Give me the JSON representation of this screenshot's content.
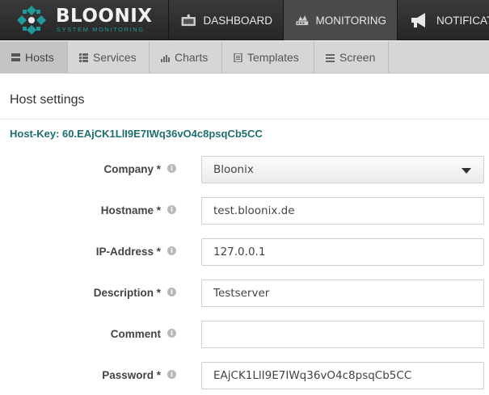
{
  "app": {
    "brand_name": "BLOONIX",
    "brand_subtitle": "SYSTEM MONITORING"
  },
  "topnav": {
    "items": [
      {
        "label": "DASHBOARD",
        "icon": "dashboard-icon"
      },
      {
        "label": "MONITORING",
        "icon": "monitoring-icon",
        "active": true
      },
      {
        "label": "NOTIFICAT",
        "icon": "megaphone-icon"
      }
    ]
  },
  "subnav": {
    "tabs": [
      {
        "label": "Hosts",
        "icon": "hosts-icon",
        "active": true
      },
      {
        "label": "Services",
        "icon": "list-icon"
      },
      {
        "label": "Charts",
        "icon": "bar-chart-icon"
      },
      {
        "label": "Templates",
        "icon": "document-icon"
      },
      {
        "label": "Screen",
        "icon": "screen-icon"
      }
    ]
  },
  "host_settings": {
    "title": "Host settings",
    "host_key": "Host-Key: 60.EAjCK1LlI9E7IWq36vO4c8psqCb5CC",
    "info_glyph": "i",
    "fields": {
      "company": {
        "label": "Company *",
        "value": "Bloonix"
      },
      "hostname": {
        "label": "Hostname *",
        "value": "test.bloonix.de"
      },
      "ip_address": {
        "label": "IP-Address *",
        "value": "127.0.0.1"
      },
      "description": {
        "label": "Description *",
        "value": "Testserver"
      },
      "comment": {
        "label": "Comment",
        "value": ""
      },
      "password": {
        "label": "Password *",
        "value": "EAjCK1LlI9E7IWq36vO4c8psqCb5CC"
      }
    }
  },
  "colors": {
    "header_bg": "#2e2e2e",
    "accent_teal": "#1f9a9a",
    "hostkey_text": "#1e6e6e",
    "subnav_bg": "#d6d6d6"
  }
}
